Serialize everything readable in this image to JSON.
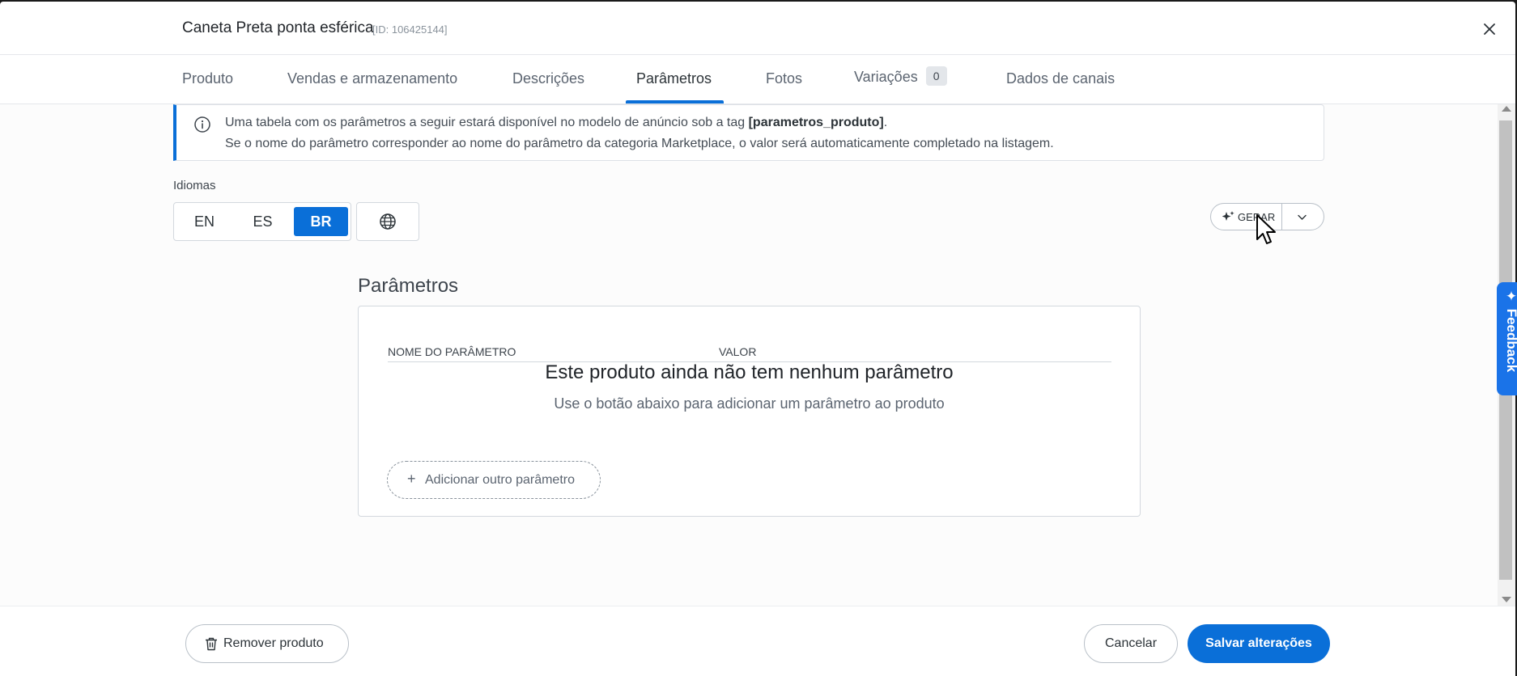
{
  "header": {
    "title": "Caneta Preta ponta esférica",
    "id_label": "[ID: 106425144]"
  },
  "tabs": [
    {
      "label": "Produto"
    },
    {
      "label": "Vendas e armazenamento"
    },
    {
      "label": "Descrições"
    },
    {
      "label": "Parâmetros"
    },
    {
      "label": "Fotos"
    },
    {
      "label": "Variações",
      "badge": "0"
    },
    {
      "label": "Dados de canais"
    }
  ],
  "active_tab": "Parâmetros",
  "info": {
    "line1_prefix": "Uma tabela com os parâmetros a seguir estará disponível no modelo de anúncio sob a tag ",
    "line1_tag": "[parametros_produto]",
    "line1_suffix": ".",
    "line2": "Se o nome do parâmetro corresponder ao nome do parâmetro da categoria Marketplace, o valor será automaticamente completado na listagem."
  },
  "languages": {
    "label": "Idiomas",
    "options": [
      "EN",
      "ES",
      "BR"
    ],
    "selected": "BR"
  },
  "generate": {
    "label": "GERAR"
  },
  "parameters": {
    "section_title": "Parâmetros",
    "columns": [
      "NOME DO PARÂMETRO",
      "VALOR"
    ],
    "empty_title": "Este produto ainda não tem nenhum parâmetro",
    "empty_subtitle": "Use o botão abaixo para adicionar um parâmetro ao produto",
    "add_button": "Adicionar outro parâmetro"
  },
  "feedback": {
    "label": "✦ Feedback"
  },
  "footer": {
    "remove": "Remover produto",
    "cancel": "Cancelar",
    "save": "Salvar alterações"
  },
  "colors": {
    "accent": "#0a6fd8",
    "text": "#2c3338",
    "muted": "#5b6470",
    "border": "#d3d8de"
  },
  "icons": [
    "close-icon",
    "info-icon",
    "globe-icon",
    "sparkle-icon",
    "chevron-down-icon",
    "plus-icon",
    "trash-icon",
    "mouse-cursor-icon"
  ]
}
